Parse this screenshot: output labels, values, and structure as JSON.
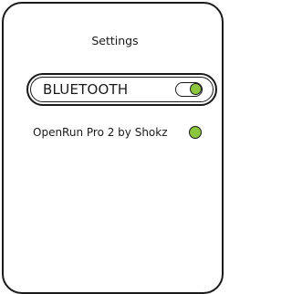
{
  "screen": {
    "title": "Settings"
  },
  "bluetooth": {
    "label": "BLUETOOTH",
    "toggle_state": "on",
    "toggle_color": "#8cc63f"
  },
  "device": {
    "name": "OpenRun Pro 2 by Shokz",
    "status_color": "#8cc63f"
  }
}
